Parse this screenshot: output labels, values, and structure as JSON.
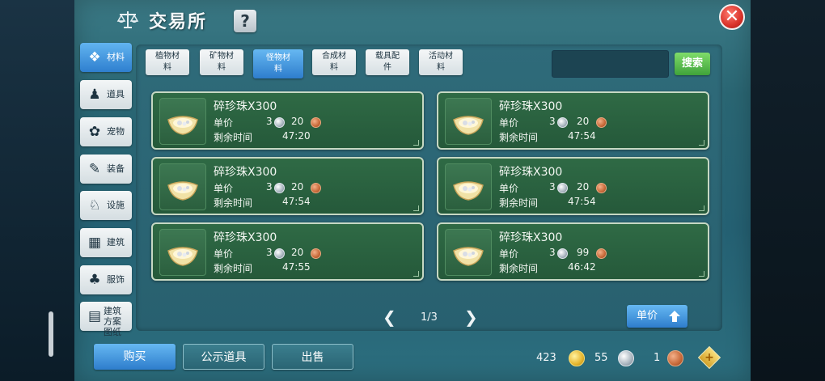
{
  "title": "交易所",
  "help_label": "?",
  "close_label": "✕",
  "sidebar": {
    "items": [
      {
        "label": "材料",
        "icon": "materials-icon",
        "glyph": "❖"
      },
      {
        "label": "道具",
        "icon": "tool-icon",
        "glyph": "♟"
      },
      {
        "label": "宠物",
        "icon": "paw-icon",
        "glyph": "✿"
      },
      {
        "label": "装备",
        "icon": "equipment-icon",
        "glyph": "✎"
      },
      {
        "label": "设施",
        "icon": "facility-icon",
        "glyph": "♘"
      },
      {
        "label": "建筑",
        "icon": "building-icon",
        "glyph": "▦"
      },
      {
        "label": "服饰",
        "icon": "clothing-icon",
        "glyph": "♣"
      },
      {
        "label": "建筑方案图纸",
        "icon": "blueprint-icon",
        "glyph": "▤"
      }
    ]
  },
  "tabs": [
    {
      "line1": "植物材",
      "line2": "料"
    },
    {
      "line1": "矿物材",
      "line2": "料"
    },
    {
      "line1": "怪物材",
      "line2": "料"
    },
    {
      "line1": "合成材",
      "line2": "料"
    },
    {
      "line1": "载具配",
      "line2": "件"
    },
    {
      "line1": "活动材",
      "line2": "料"
    }
  ],
  "search": {
    "placeholder": "",
    "button_label": "搜索"
  },
  "listing_labels": {
    "price": "单价",
    "time_left": "剩余时间"
  },
  "listings": [
    {
      "name": "碎珍珠X300",
      "silver": "3",
      "copper": "20",
      "time": "47:20"
    },
    {
      "name": "碎珍珠X300",
      "silver": "3",
      "copper": "20",
      "time": "47:54"
    },
    {
      "name": "碎珍珠X300",
      "silver": "3",
      "copper": "20",
      "time": "47:54"
    },
    {
      "name": "碎珍珠X300",
      "silver": "3",
      "copper": "20",
      "time": "47:54"
    },
    {
      "name": "碎珍珠X300",
      "silver": "3",
      "copper": "20",
      "time": "47:55"
    },
    {
      "name": "碎珍珠X300",
      "silver": "3",
      "copper": "99",
      "time": "46:42"
    }
  ],
  "pager": {
    "text": "1/3",
    "prev": "❮",
    "next": "❯"
  },
  "sort": {
    "label": "单价"
  },
  "bottom": {
    "buy": "购买",
    "public": "公示道具",
    "sell": "出售"
  },
  "currency": {
    "gold": "423",
    "silver": "55",
    "copper": "1",
    "plus": "+"
  },
  "colors": {
    "accent_blue": "#2e7dcc",
    "card_green": "#2f6a45",
    "search_green": "#3fa33a",
    "close_red": "#d8322a"
  }
}
